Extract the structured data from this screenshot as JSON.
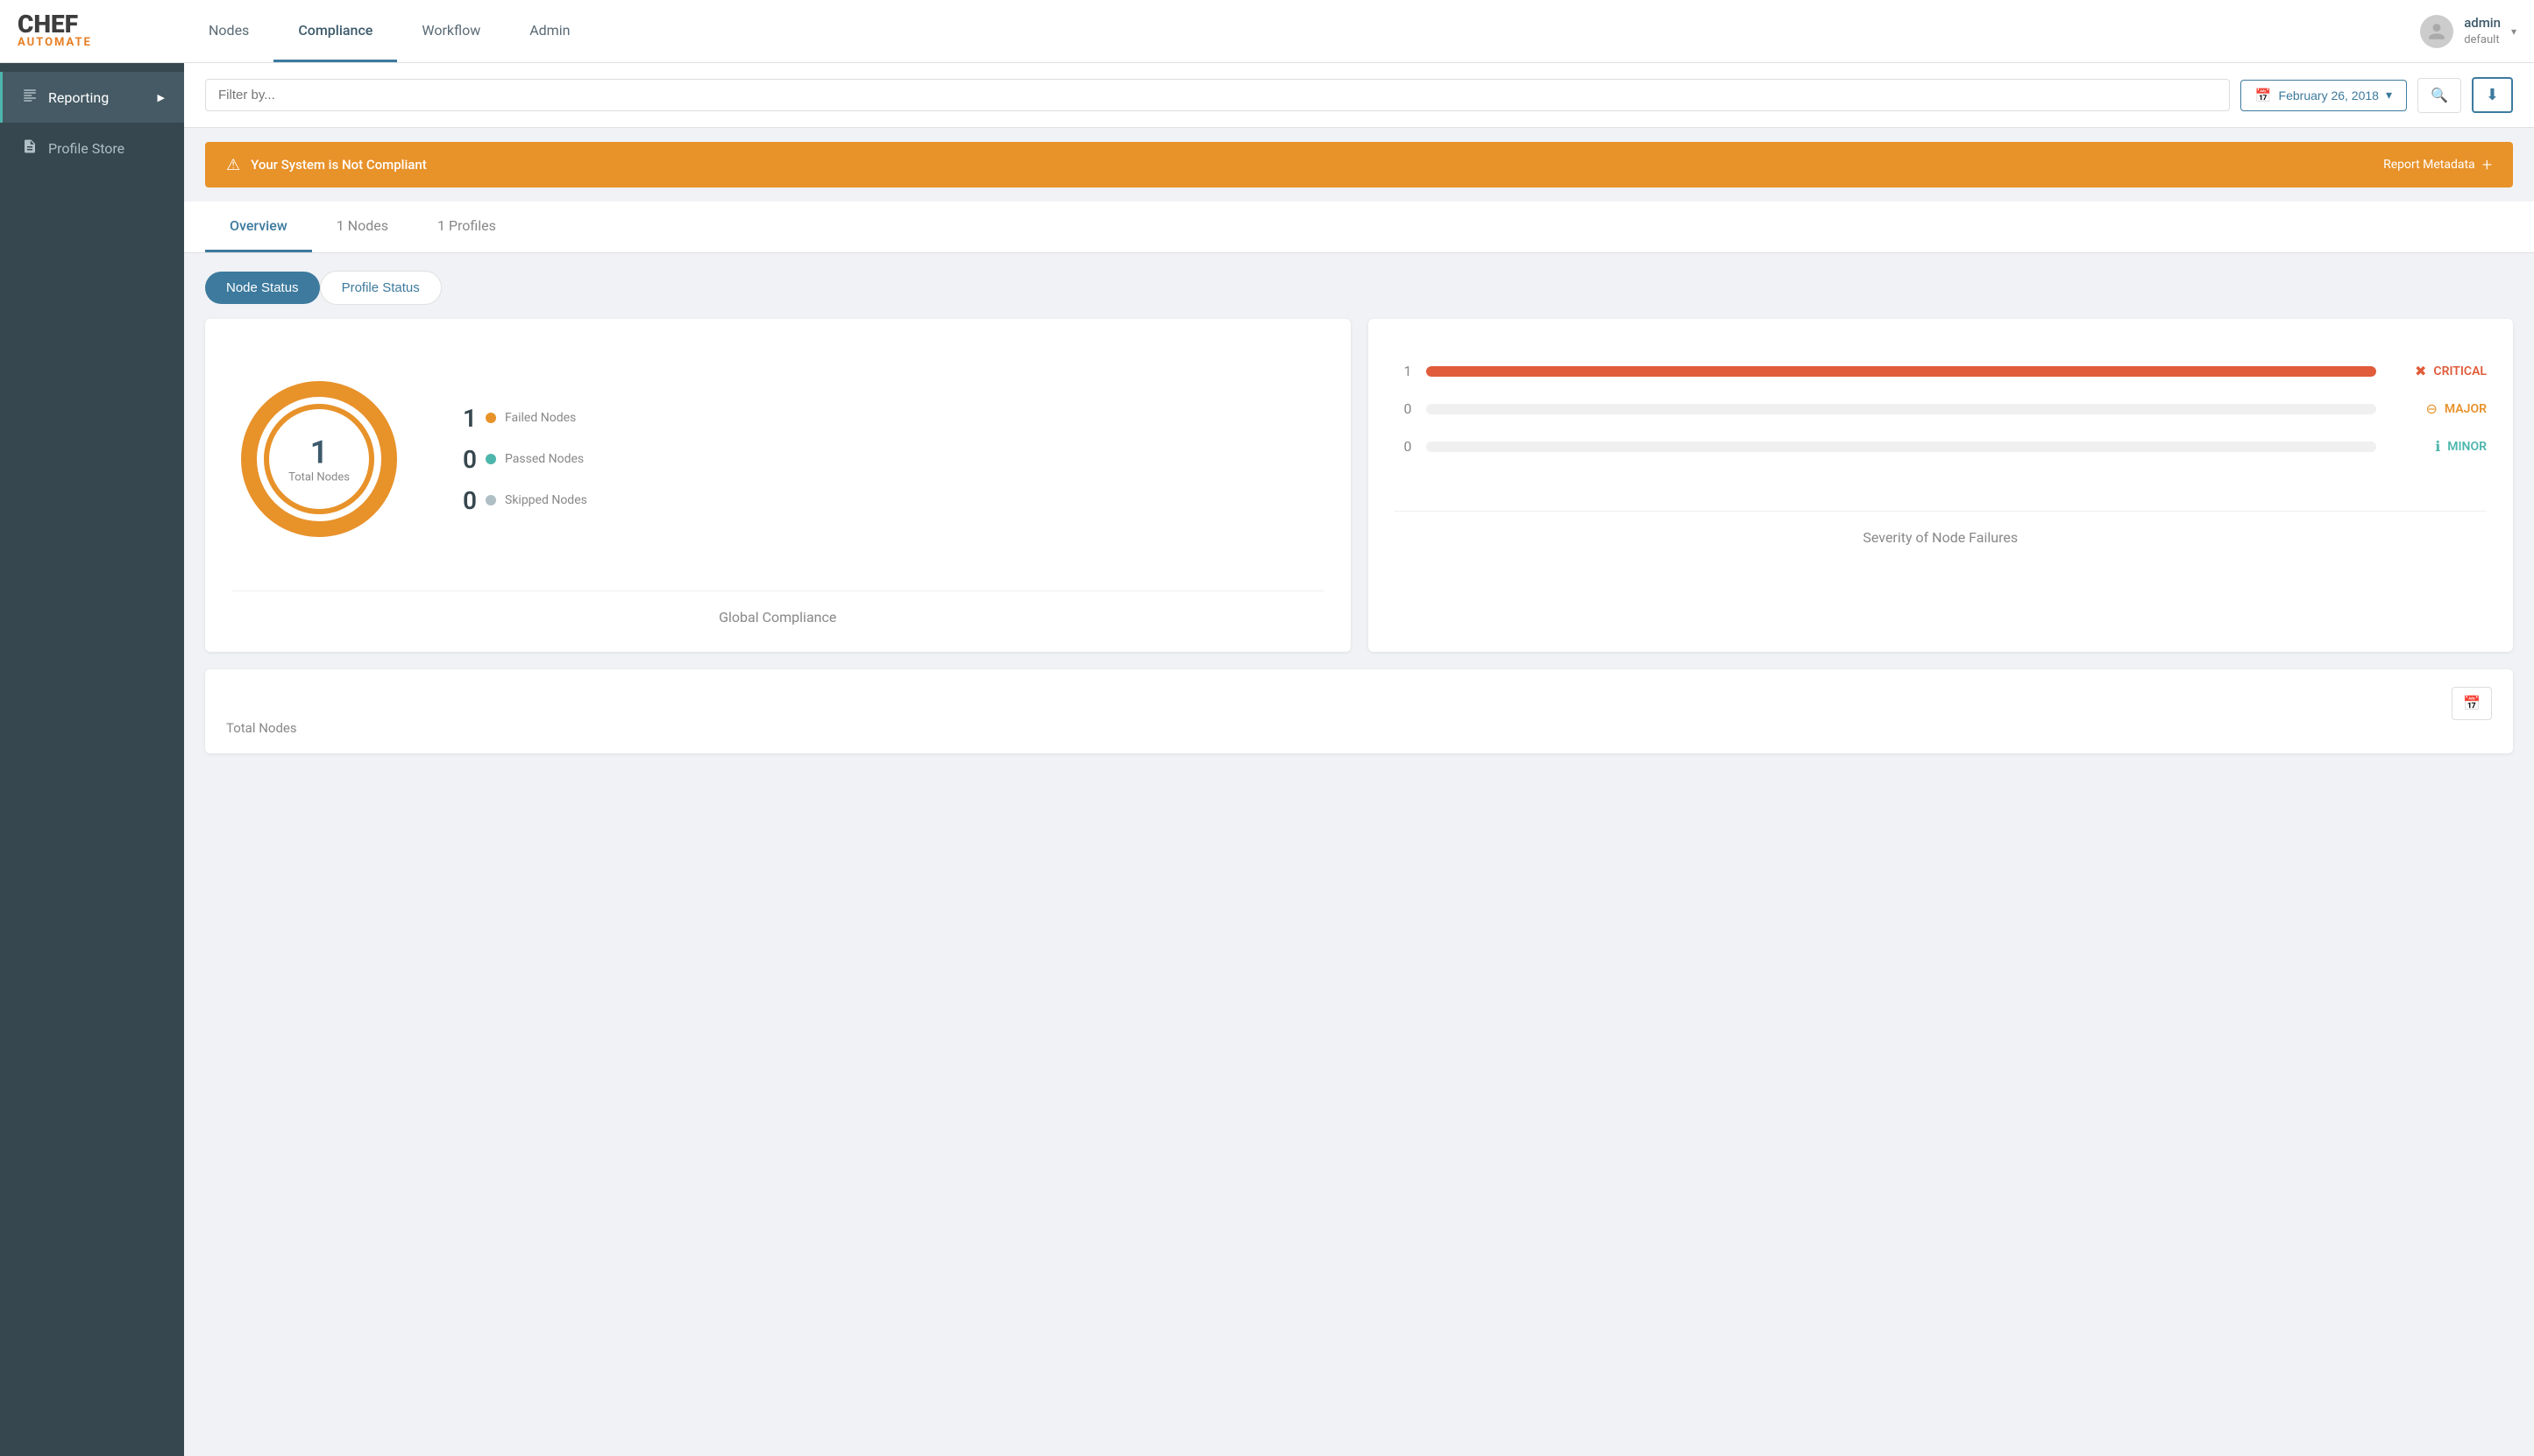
{
  "app": {
    "name": "CHEF",
    "sub": "AUTOMATE"
  },
  "nav": {
    "links": [
      {
        "label": "Nodes",
        "active": false
      },
      {
        "label": "Compliance",
        "active": true
      },
      {
        "label": "Workflow",
        "active": false
      },
      {
        "label": "Admin",
        "active": false
      }
    ]
  },
  "user": {
    "name": "admin",
    "role": "default"
  },
  "sidebar": {
    "items": [
      {
        "label": "Reporting",
        "icon": "📈",
        "active": true,
        "arrow": true
      },
      {
        "label": "Profile Store",
        "icon": "📄",
        "active": false,
        "arrow": false
      }
    ]
  },
  "filter": {
    "placeholder": "Filter by...",
    "date": "February 26, 2018"
  },
  "alert": {
    "text": "Your System is Not Compliant",
    "meta_label": "Report Metadata"
  },
  "tabs": {
    "items": [
      {
        "label": "Overview",
        "active": true
      },
      {
        "label": "1 Nodes",
        "active": false
      },
      {
        "label": "1 Profiles",
        "active": false
      }
    ]
  },
  "toggle": {
    "buttons": [
      {
        "label": "Node Status",
        "active": true
      },
      {
        "label": "Profile Status",
        "active": false
      }
    ]
  },
  "global_compliance": {
    "total_nodes": 1,
    "total_label": "Total Nodes",
    "stats": [
      {
        "count": 1,
        "label": "Failed Nodes",
        "type": "failed"
      },
      {
        "count": 0,
        "label": "Passed Nodes",
        "type": "passed"
      },
      {
        "count": 0,
        "label": "Skipped Nodes",
        "type": "skipped"
      }
    ],
    "title": "Global Compliance"
  },
  "severity": {
    "title": "Severity of Node Failures",
    "items": [
      {
        "label": "CRITICAL",
        "type": "critical",
        "value": 1,
        "bar_pct": 100,
        "icon": "✖"
      },
      {
        "label": "MAJOR",
        "type": "major",
        "value": 0,
        "bar_pct": 0,
        "icon": "➖"
      },
      {
        "label": "MINOR",
        "type": "minor",
        "value": 0,
        "bar_pct": 0,
        "icon": "ℹ"
      }
    ]
  },
  "bottom_card": {
    "title": "Total Nodes"
  }
}
